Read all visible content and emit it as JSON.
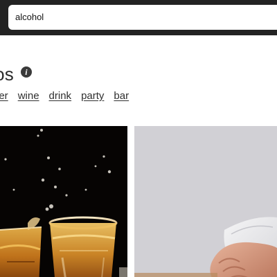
{
  "search": {
    "value": "alcohol"
  },
  "heading": {
    "title": "otos"
  },
  "tags": [
    {
      "label": "eer"
    },
    {
      "label": "wine"
    },
    {
      "label": "drink"
    },
    {
      "label": "party"
    },
    {
      "label": "bar"
    }
  ],
  "icons": {
    "info": "info-icon"
  },
  "colors": {
    "topbar": "#232323",
    "left_photo_background": "#050302",
    "right_photo_background": "#d0cfd4"
  }
}
